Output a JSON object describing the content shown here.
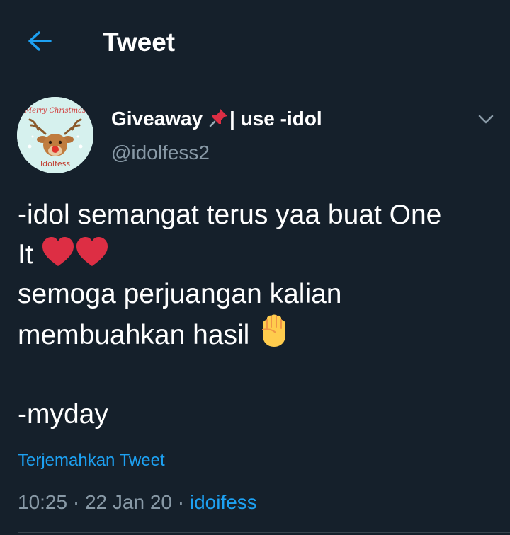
{
  "header": {
    "title": "Tweet",
    "back_icon": "arrow-left-icon"
  },
  "author": {
    "display_name_prefix": "Giveaway ",
    "display_name_suffix": "| use -idol",
    "name_emoji": "pushpin-icon",
    "handle": "@idolfess2",
    "avatar_text_top": "Merry Christmas",
    "avatar_text_bottom": "Idolfess"
  },
  "tweet": {
    "line1": "-idol semangat terus yaa buat One",
    "line2": "It ",
    "line3": "semoga perjuangan kalian",
    "line4": "membuahkan hasil ",
    "line6": "-myday",
    "translate_label": "Terjemahkan Tweet",
    "time": "10:25",
    "separator": " · ",
    "date": "22 Jan 20",
    "source": "idoifess"
  },
  "colors": {
    "background": "#15202b",
    "accent": "#1da1f2",
    "muted": "#8899a6",
    "divider": "#38444d"
  }
}
